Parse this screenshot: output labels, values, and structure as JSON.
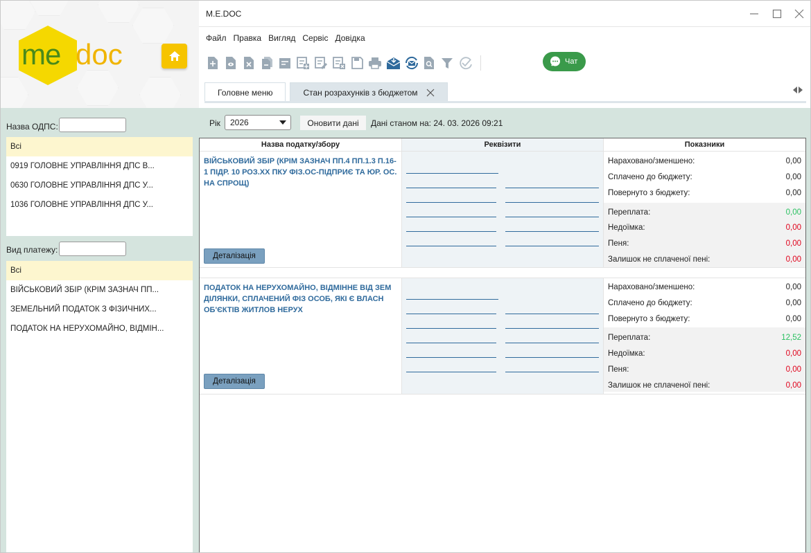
{
  "app": {
    "title": "M.E.DOC"
  },
  "logo": {
    "part1": "me",
    "part2": "doc"
  },
  "menu": [
    "Файл",
    "Правка",
    "Вигляд",
    "Сервіс",
    "Довідка"
  ],
  "toolbar": {
    "icons": [
      "add-doc-icon",
      "view-doc-icon",
      "delete-doc-icon",
      "copy-doc-icon",
      "edit-doc-icon",
      "add-sheet-icon",
      "edit-sheet-icon",
      "delete-sheet-icon",
      "save-icon",
      "print-icon",
      "receive-mail-icon",
      "sync-mail-icon",
      "search-doc-icon",
      "filter-icon",
      "check-icon"
    ],
    "chat_label": "Чат"
  },
  "tabs": [
    {
      "label": "Головне меню",
      "active": false
    },
    {
      "label": "Стан розрахунків з бюджетом",
      "active": true
    }
  ],
  "sidebar": {
    "odps_label": "Назва ОДПС:",
    "odps_items": [
      "Всі",
      "0919 ГОЛОВНЕ УПРАВЛІННЯ ДПС В...",
      "0630 ГОЛОВНЕ УПРАВЛІННЯ ДПС У...",
      "1036 ГОЛОВНЕ УПРАВЛІННЯ ДПС У..."
    ],
    "payment_label": "Вид платежу:",
    "payment_items": [
      "Всі",
      "ВІЙСЬКОВИЙ ЗБІР (КРІМ ЗАЗНАЧ ПП...",
      "ЗЕМЕЛЬНИЙ ПОДАТОК З ФІЗИЧНИХ...",
      "ПОДАТОК НА НЕРУХОМАЙНО, ВІДМІН..."
    ]
  },
  "filters": {
    "year_label": "Рік",
    "year_value": "2026",
    "refresh_label": "Оновити дані",
    "date_text": "Дані станом на: 24. 03. 2026 09:21"
  },
  "grid": {
    "headers": [
      "Назва податку/збору",
      "Реквізити",
      "Показники"
    ],
    "detail_label": "Деталізація",
    "indicator_labels": [
      "Нараховано/зменшено:",
      "Сплачено до бюджету:",
      "Повернуто з бюджету:",
      "Переплата:",
      "Недоїмка:",
      "Пеня:",
      "Залишок не сплаченої пені:"
    ],
    "rows": [
      {
        "title": "ВІЙСЬКОВИЙ ЗБІР (КРІМ ЗАЗНАЧ ПП.4 ПП.1.3 П.16-1 ПІДР. 10 РОЗ.ХХ ПКУ ФІЗ.ОС-ПІДПРИЄ ТА ЮР. ОС. НА СПРОЩ)",
        "values": [
          "0,00",
          "0,00",
          "0,00",
          "0,00",
          "0,00",
          "0,00",
          "0,00"
        ]
      },
      {
        "title": "ПОДАТОК НА НЕРУХОМАЙНО, ВІДМІННЕ ВІД ЗЕМ ДІЛЯНКИ, СПЛАЧЕНИЙ ФІЗ ОСОБ, ЯКІ Є ВЛАСН ОБ'ЄКТІВ ЖИТЛОВ НЕРУХ",
        "values": [
          "0,00",
          "0,00",
          "0,00",
          "12,52",
          "0,00",
          "0,00",
          "0,00"
        ]
      }
    ]
  },
  "colors": {
    "accent_blue": "#2f6a9c",
    "positive": "#29c060",
    "negative": "#e0001a",
    "sidebar_bg": "#d5e4de",
    "chat_green": "#3a9a4a"
  }
}
